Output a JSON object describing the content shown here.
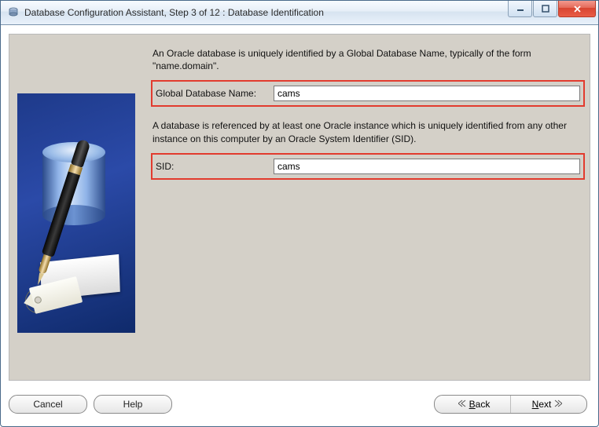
{
  "window": {
    "title": "Database Configuration Assistant, Step 3 of 12 : Database Identification"
  },
  "intro1": "An Oracle database is uniquely identified by a Global Database Name, typically of the form \"name.domain\".",
  "gdb": {
    "label": "Global Database Name:",
    "value": "cams"
  },
  "intro2": "A database is referenced by at least one Oracle instance which is uniquely identified from any other instance on this computer by an Oracle System Identifier (SID).",
  "sid": {
    "label": "SID:",
    "value": "cams"
  },
  "buttons": {
    "cancel": "Cancel",
    "help": "Help",
    "back_prefix": "B",
    "back_rest": "ack",
    "next_prefix": "N",
    "next_rest": "ext"
  }
}
